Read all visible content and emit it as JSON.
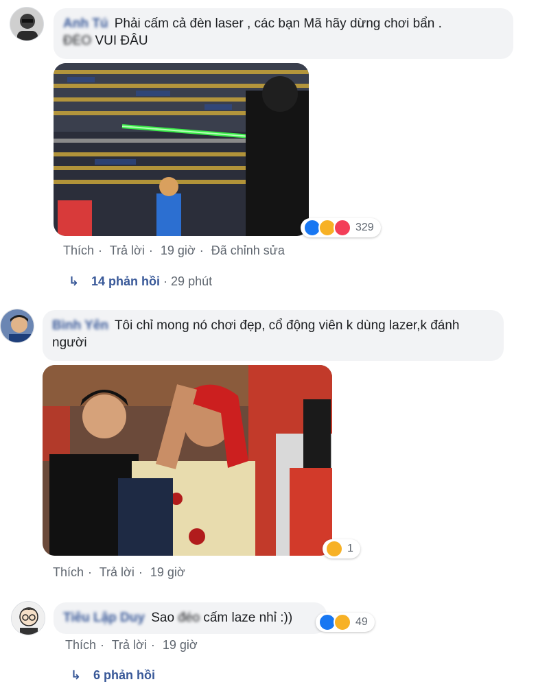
{
  "comments": [
    {
      "author": "Anh Tú",
      "text_line1": "Phải cấm cả đèn laser , các bạn Mã hãy dừng chơi bẩn .",
      "text_blur_word": "ĐÉO",
      "text_line2": "VUI ĐÂU",
      "reactions": {
        "icons": [
          "like-icon",
          "haha-icon",
          "love-icon"
        ],
        "count": "329"
      },
      "actions": {
        "like": "Thích",
        "reply": "Trả lời",
        "time": "19 giờ",
        "edited": "Đã chỉnh sửa"
      },
      "replies": {
        "label": "14 phản hồi",
        "time": "29 phút"
      }
    },
    {
      "author": "Bình Yên",
      "text": "Tôi chỉ mong nó chơi đẹp, cổ động viên k dùng lazer,k đánh người",
      "reactions": {
        "icons": [
          "haha-icon"
        ],
        "count": "1"
      },
      "actions": {
        "like": "Thích",
        "reply": "Trả lời",
        "time": "19 giờ"
      }
    },
    {
      "author": "Tiêu Lập Duy",
      "text_before": "Sao",
      "text_blur_word": "đéo",
      "text_after": "cấm laze nhỉ :))",
      "reactions": {
        "icons": [
          "like-icon",
          "haha-icon"
        ],
        "count": "49"
      },
      "actions": {
        "like": "Thích",
        "reply": "Trả lời",
        "time": "19 giờ"
      },
      "replies": {
        "label": "6 phản hồi"
      }
    }
  ],
  "colors": {
    "link": "#385898",
    "meta": "#606770",
    "bubble": "#f2f3f5"
  }
}
